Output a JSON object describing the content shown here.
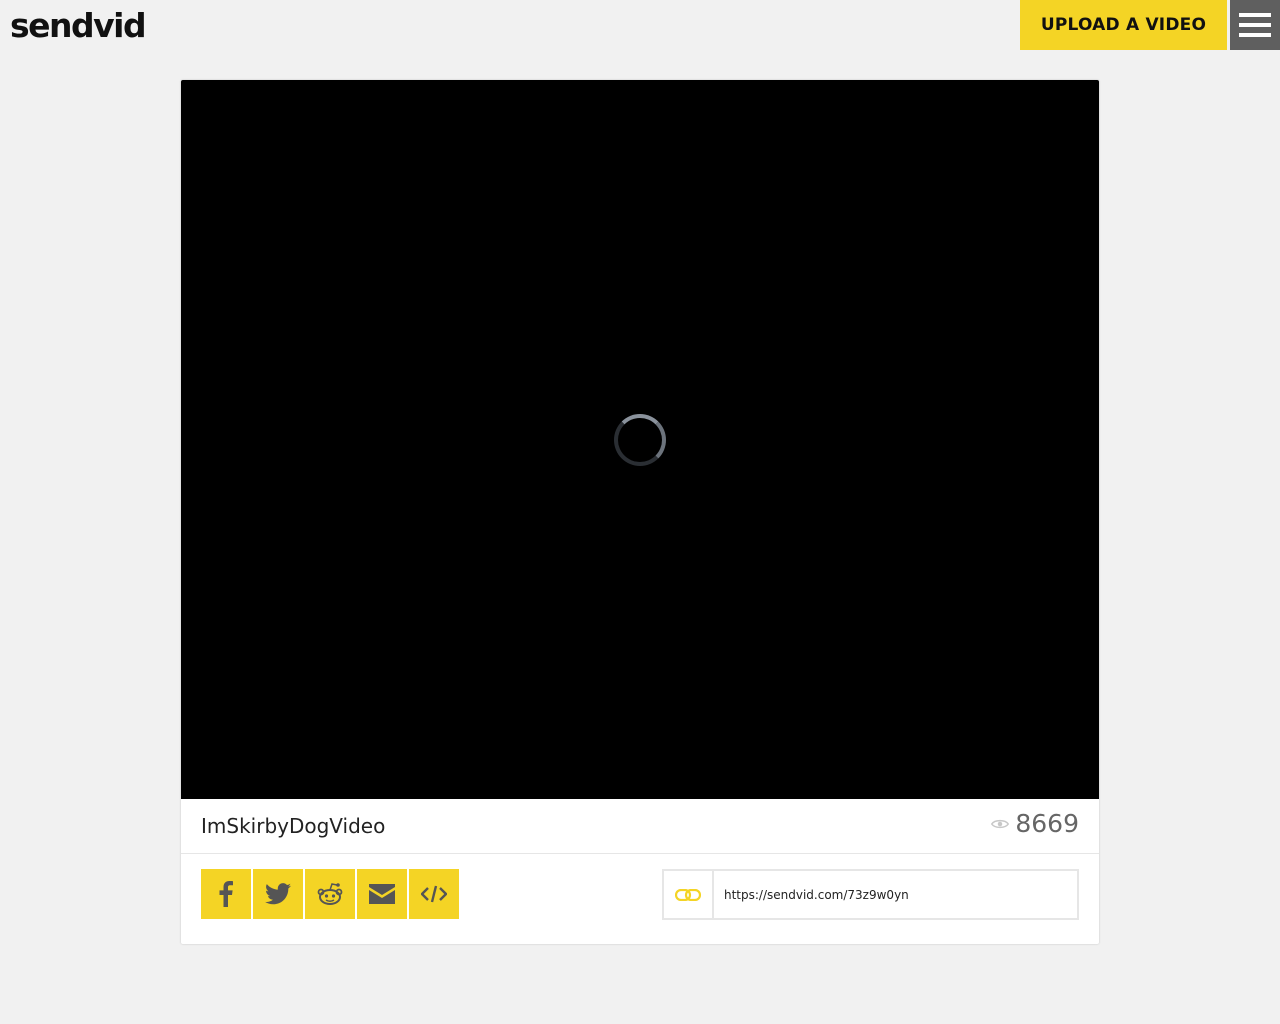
{
  "header": {
    "logo": "sendvid",
    "upload_label": "UPLOAD A VIDEO",
    "menu_icon": "hamburger-icon"
  },
  "video": {
    "title": "ImSkirbyDogVideo",
    "views": "8669",
    "state": "loading"
  },
  "share": {
    "buttons": [
      {
        "name": "facebook",
        "icon": "facebook-icon"
      },
      {
        "name": "twitter",
        "icon": "twitter-icon"
      },
      {
        "name": "reddit",
        "icon": "reddit-icon"
      },
      {
        "name": "email",
        "icon": "mail-icon"
      },
      {
        "name": "embed",
        "icon": "code-icon"
      }
    ],
    "link": "https://sendvid.com/73z9w0yn",
    "link_icon": "chain-link-icon"
  },
  "colors": {
    "accent": "#f4d425",
    "menu_bg": "#5f5f5f",
    "page_bg": "#f1f1f1",
    "player_bg": "#000000"
  }
}
